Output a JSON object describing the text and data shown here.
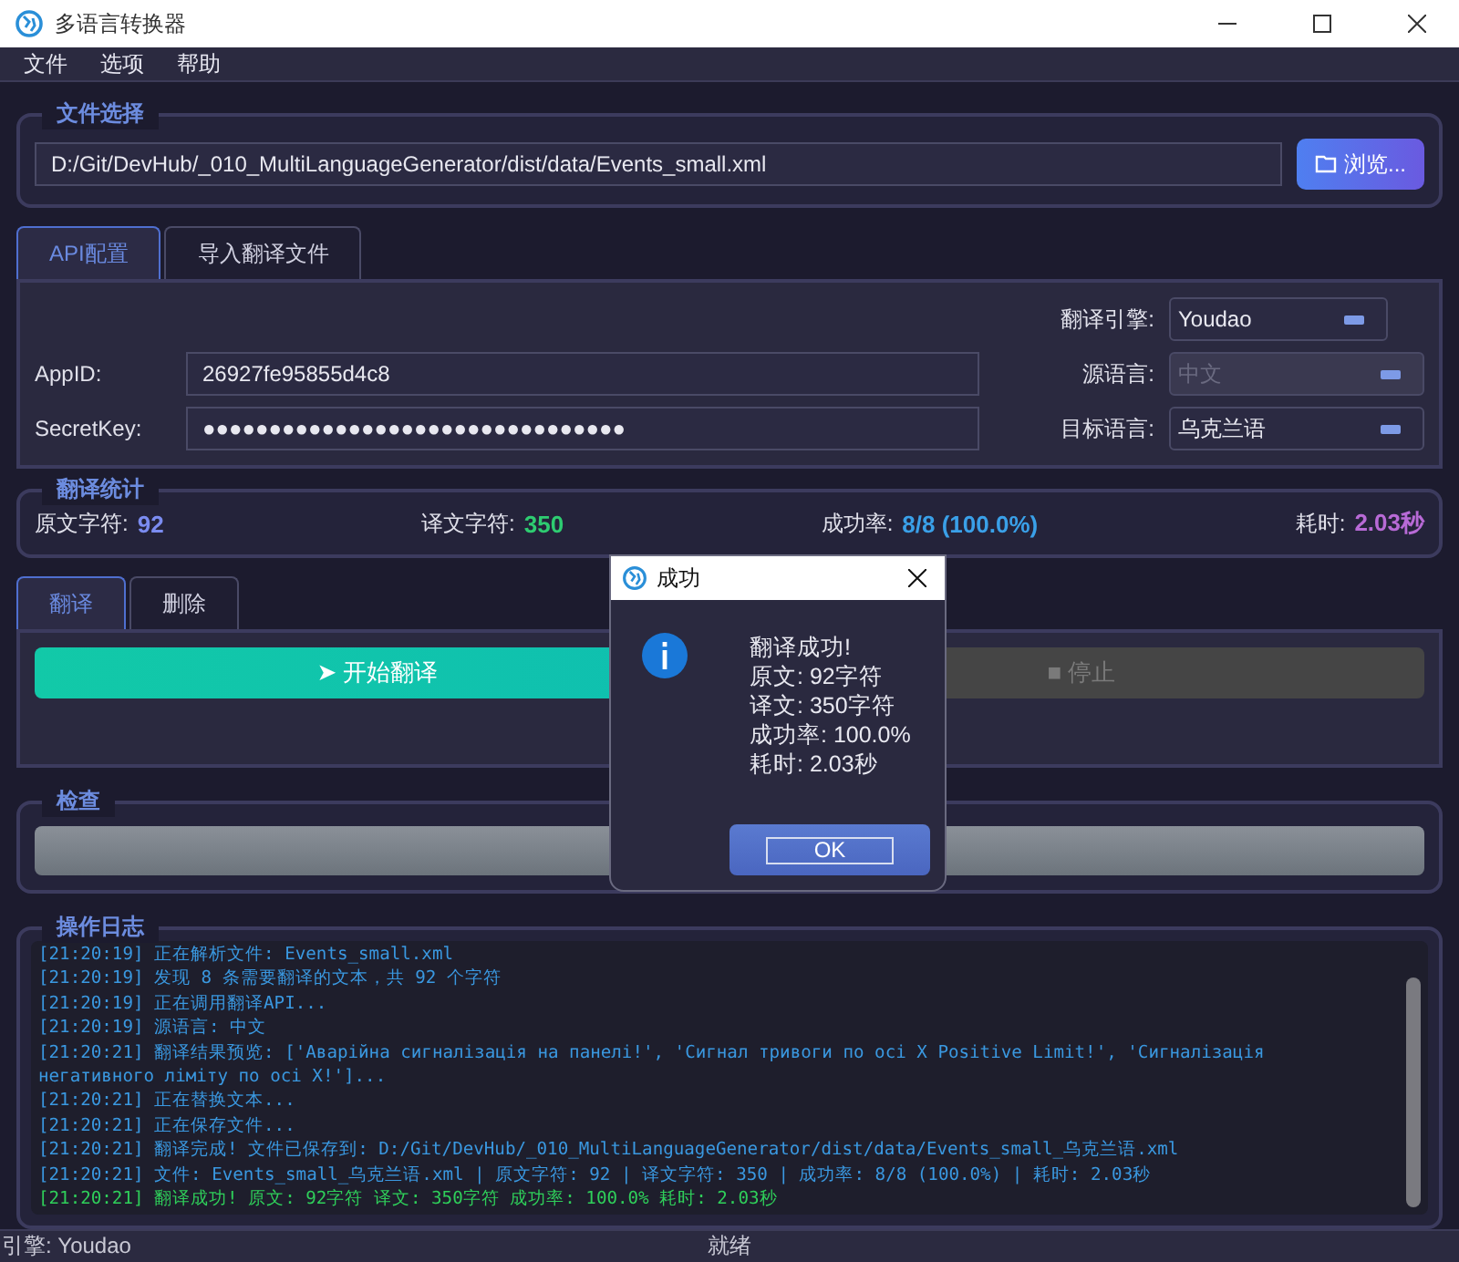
{
  "window": {
    "title": "多语言转换器"
  },
  "menu": [
    "文件",
    "选项",
    "帮助"
  ],
  "file_group": {
    "title": "文件选择",
    "path": "D:/Git/DevHub/_010_MultiLanguageGenerator/dist/data/Events_small.xml",
    "browse": "浏览..."
  },
  "config_tabs": [
    {
      "label": "API配置",
      "selected": true
    },
    {
      "label": "导入翻译文件",
      "selected": false
    }
  ],
  "api": {
    "fields": [
      {
        "label": "AppID:",
        "value": "26927fe95855d4c8"
      },
      {
        "label": "SecretKey:",
        "value": "●●●●●●●●●●●●●●●●●●●●●●●●●●●●●●●●"
      }
    ],
    "combos": [
      {
        "label": "翻译引擎:",
        "value": "Youdao",
        "disabled": false
      },
      {
        "label": "源语言:",
        "value": "中文",
        "disabled": true
      },
      {
        "label": "目标语言:",
        "value": "乌克兰语",
        "disabled": false
      }
    ]
  },
  "stats": {
    "title": "翻译统计",
    "items": [
      {
        "label": "原文字符:",
        "value": "92",
        "color": "#7b8cf0"
      },
      {
        "label": "译文字符:",
        "value": "350",
        "color": "#2ecc71"
      },
      {
        "label": "成功率:",
        "value": "8/8 (100.0%)",
        "color": "#3aa0e8"
      },
      {
        "label": "耗时:",
        "value": "2.03秒",
        "color": "#b86ad6"
      }
    ]
  },
  "action_tabs": [
    {
      "label": "翻译",
      "selected": true
    },
    {
      "label": "删除",
      "selected": false
    }
  ],
  "buttons": [
    {
      "label": "➤ 开始翻译",
      "disabled": false
    },
    {
      "label": "■ 停止",
      "disabled": true
    }
  ],
  "check_group": {
    "title": "检查"
  },
  "log": {
    "title": "操作日志",
    "lines": [
      {
        "text": "[21:20:19] 正在解析文件: Events_small.xml",
        "kind": "info"
      },
      {
        "text": "[21:20:19] 发现 8 条需要翻译的文本，共 92 个字符",
        "kind": "info"
      },
      {
        "text": "[21:20:19] 正在调用翻译API...",
        "kind": "info"
      },
      {
        "text": "[21:20:19] 源语言: 中文",
        "kind": "info"
      },
      {
        "text": "[21:20:21] 翻译结果预览: ['Аварійна сигналізація на панелі!', 'Сигнал тривоги по осі X Positive Limit!', 'Сигналізація негативного ліміту по осі X!']...",
        "kind": "info"
      },
      {
        "text": "[21:20:21] 正在替换文本...",
        "kind": "info"
      },
      {
        "text": "[21:20:21] 正在保存文件...",
        "kind": "info"
      },
      {
        "text": "[21:20:21] 翻译完成! 文件已保存到: D:/Git/DevHub/_010_MultiLanguageGenerator/dist/data/Events_small_乌克兰语.xml",
        "kind": "info"
      },
      {
        "text": "[21:20:21] 文件: Events_small_乌克兰语.xml | 原文字符: 92 | 译文字符: 350 | 成功率: 8/8 (100.0%) | 耗时: 2.03秒",
        "kind": "info"
      },
      {
        "text": "[21:20:21] 翻译成功! 原文: 92字符 译文: 350字符 成功率: 100.0% 耗时: 2.03秒",
        "kind": "success"
      }
    ]
  },
  "status_bar": {
    "left": "引擎: Youdao",
    "center": "就绪"
  },
  "dialog": {
    "title": "成功",
    "lines": [
      "翻译成功!",
      "原文: 92字符",
      "译文: 350字符",
      "成功率: 100.0%",
      "耗时: 2.03秒"
    ],
    "ok": "OK"
  }
}
